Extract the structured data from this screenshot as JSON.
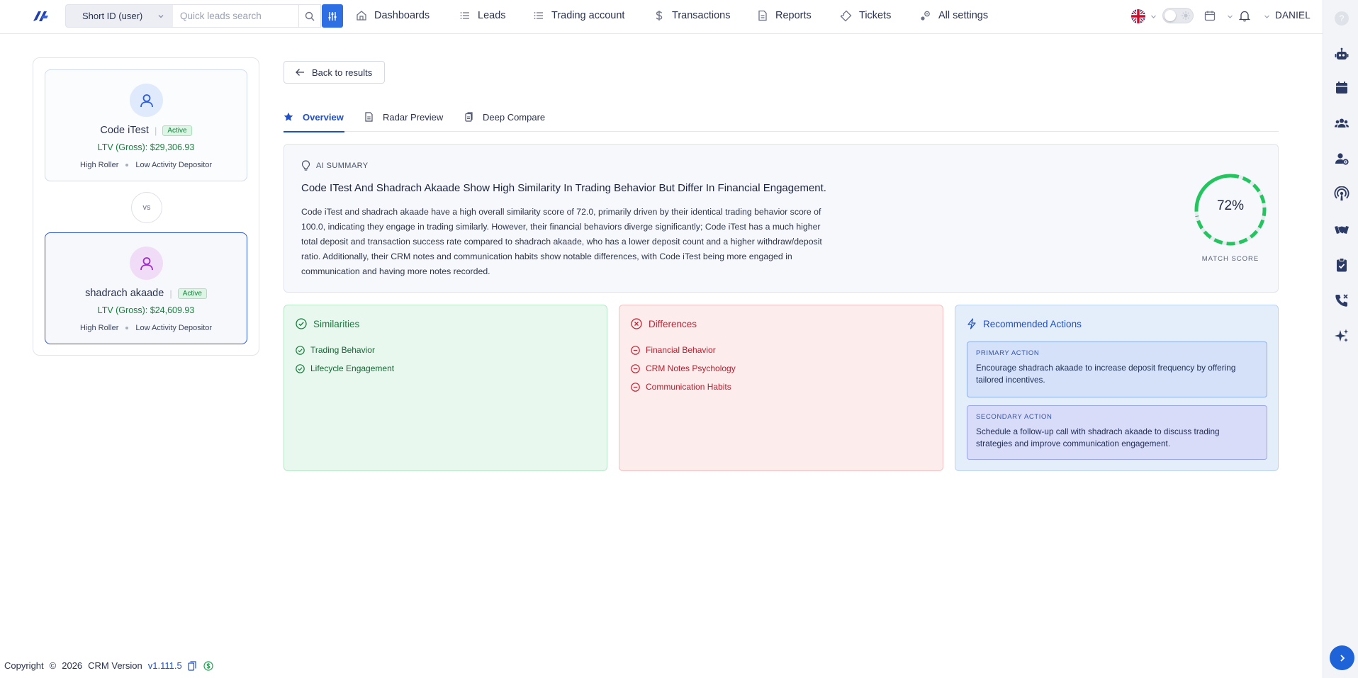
{
  "topbar": {
    "search_type": "Short ID (user)",
    "search_placeholder": "Quick leads search",
    "nav": [
      {
        "label": "Dashboards",
        "icon": "home-icon"
      },
      {
        "label": "Leads",
        "icon": "list-icon"
      },
      {
        "label": "Trading account",
        "icon": "list-icon"
      },
      {
        "label": "Transactions",
        "icon": "dollar-icon"
      },
      {
        "label": "Reports",
        "icon": "document-icon"
      },
      {
        "label": "Tickets",
        "icon": "ticket-icon"
      },
      {
        "label": "All settings",
        "icon": "settings-icon"
      }
    ],
    "user": "DANIEL"
  },
  "leads": [
    {
      "name": "Code iTest",
      "status": "Active",
      "ltv": "LTV (Gross): $29,306.93",
      "tags": [
        "High Roller",
        "Low Activity Depositor"
      ]
    },
    {
      "name": "shadrach akaade",
      "status": "Active",
      "ltv": "LTV (Gross): $24,609.93",
      "tags": [
        "High Roller",
        "Low Activity Depositor"
      ]
    }
  ],
  "vs_label": "vs",
  "back_label": "Back to results",
  "tabs": [
    {
      "label": "Overview",
      "active": true
    },
    {
      "label": "Radar Preview",
      "active": false
    },
    {
      "label": "Deep Compare",
      "active": false
    }
  ],
  "summary": {
    "label": "AI SUMMARY",
    "title": "Code ITest And Shadrach Akaade Show High Similarity In Trading Behavior But Differ In Financial Engagement.",
    "text": "Code iTest and shadrach akaade have a high overall similarity score of 72.0, primarily driven by their identical trading behavior score of 100.0, indicating they engage in trading similarly. However, their financial behaviors diverge significantly; Code iTest has a much higher total deposit and transaction success rate compared to shadrach akaade, who has a lower deposit count and a higher withdraw/deposit ratio. Additionally, their CRM notes and communication habits show notable differences, with Code iTest being more engaged in communication and having more notes recorded.",
    "score": 72,
    "score_text": "72%",
    "score_label": "MATCH SCORE",
    "score_color": "#22c55e"
  },
  "similarities": {
    "title": "Similarities",
    "items": [
      "Trading Behavior",
      "Lifecycle Engagement"
    ]
  },
  "differences": {
    "title": "Differences",
    "items": [
      "Financial Behavior",
      "CRM Notes Psychology",
      "Communication Habits"
    ]
  },
  "recommended": {
    "title": "Recommended Actions",
    "primary_label": "PRIMARY ACTION",
    "primary_text": "Encourage shadrach akaade to increase deposit frequency by offering tailored incentives.",
    "secondary_label": "SECONDARY ACTION",
    "secondary_text": "Schedule a follow-up call with shadrach akaade to discuss trading strategies and improve communication engagement."
  },
  "footer": {
    "copyright": "Copyright",
    "symbol": "©",
    "year": "2026",
    "crm_label": "CRM Version",
    "version": "v1.111.5"
  },
  "colors": {
    "accent": "#1f4fc9",
    "success": "#15803d",
    "danger": "#c02434"
  }
}
